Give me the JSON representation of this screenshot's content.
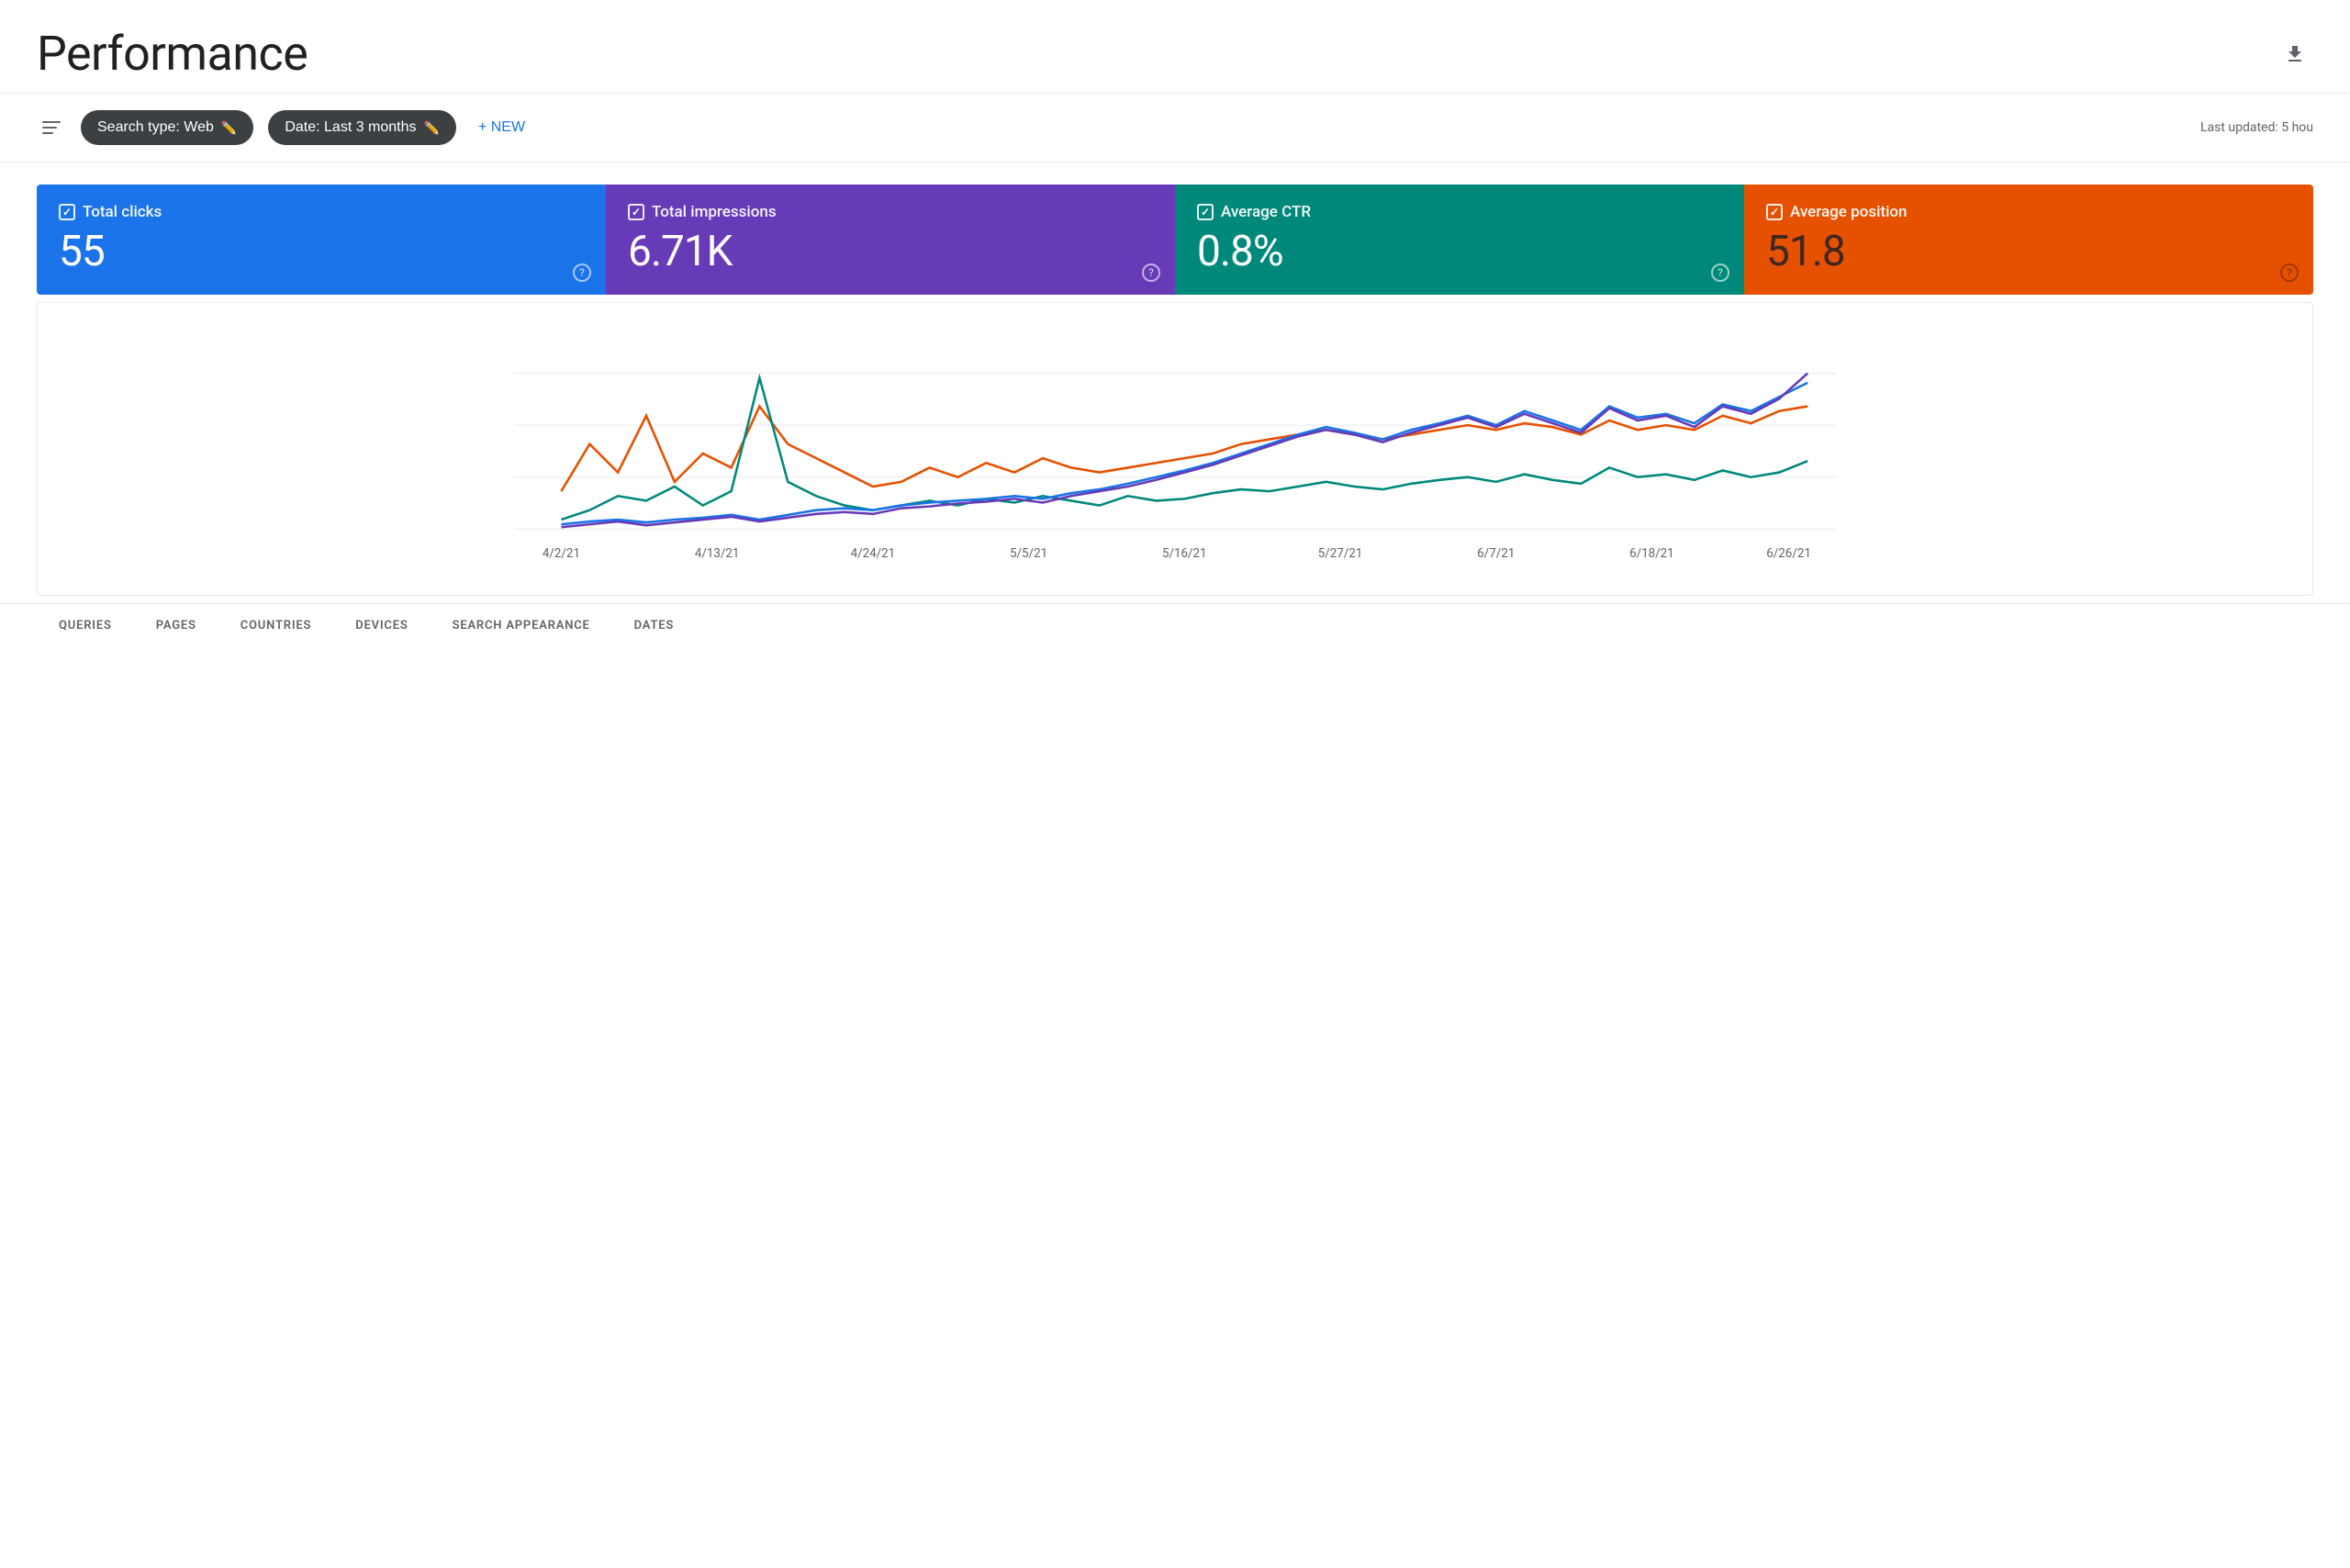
{
  "header": {
    "title": "Performance",
    "last_updated": "Last updated: 5 hou"
  },
  "toolbar": {
    "search_type_label": "Search type: Web",
    "date_label": "Date: Last 3 months",
    "new_label": "+ NEW",
    "filter_tooltip": "Filter"
  },
  "metrics": [
    {
      "id": "clicks",
      "label": "Total clicks",
      "value": "55",
      "color": "#1a73e8"
    },
    {
      "id": "impressions",
      "label": "Total impressions",
      "value": "6.71K",
      "color": "#673ab7"
    },
    {
      "id": "ctr",
      "label": "Average CTR",
      "value": "0.8%",
      "color": "#00897b"
    },
    {
      "id": "position",
      "label": "Average position",
      "value": "51.8",
      "color": "#e65100"
    }
  ],
  "chart": {
    "x_labels": [
      "4/2/21",
      "4/13/21",
      "4/24/21",
      "5/5/21",
      "5/16/21",
      "5/27/21",
      "6/7/21",
      "6/18/21",
      "6/26/21"
    ],
    "lines": [
      {
        "id": "clicks",
        "color": "#1a73e8"
      },
      {
        "id": "impressions",
        "color": "#673ab7"
      },
      {
        "id": "ctr",
        "color": "#00897b"
      },
      {
        "id": "position",
        "color": "#e65100"
      }
    ]
  },
  "tabs": [
    {
      "id": "queries",
      "label": "QUERIES"
    },
    {
      "id": "pages",
      "label": "PAGES"
    },
    {
      "id": "countries",
      "label": "COUNTRIES"
    },
    {
      "id": "devices",
      "label": "DEVICES"
    },
    {
      "id": "search_appearance",
      "label": "SEARCH APPEARANCE"
    },
    {
      "id": "dates",
      "label": "DATES"
    }
  ]
}
